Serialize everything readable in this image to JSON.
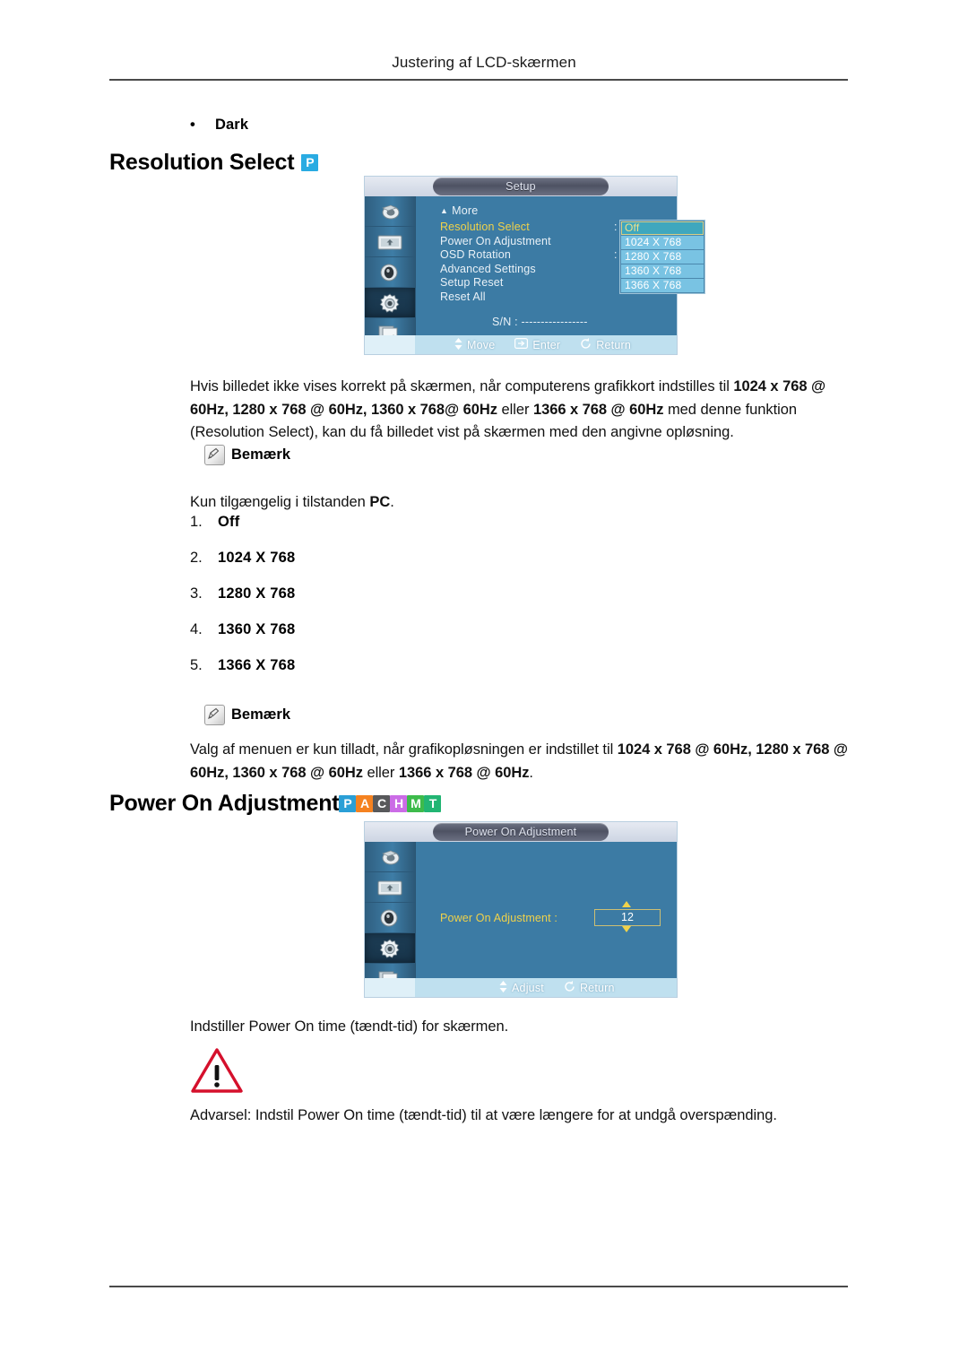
{
  "header": {
    "running_title": "Justering af LCD-skærmen"
  },
  "bullet": {
    "marker": "•",
    "label": "Dark"
  },
  "sections": {
    "resolution_select": {
      "title": "Resolution Select",
      "badges": [
        {
          "letter": "P",
          "color": "#29abe2"
        }
      ],
      "paragraph_plain_1": "Hvis billedet ikke vises korrekt på skærmen, når computerens grafikkort indstilles til ",
      "paragraph_bold_1": "1024 x 768 @ 60Hz, 1280 x 768 @ 60Hz, 1360 x 768@ 60Hz",
      "paragraph_plain_2": " eller ",
      "paragraph_bold_2": "1366 x 768 @ 60Hz",
      "paragraph_plain_3": " med denne funktion (Resolution Select), kan du få billedet vist på skærmen med den angivne opløsning.",
      "note_label": "Bemærk",
      "note_text_plain": "Kun tilgængelig i tilstanden ",
      "note_text_bold": "PC",
      "note_text_end": ".",
      "options": [
        {
          "num": "1.",
          "value": "Off"
        },
        {
          "num": "2.",
          "value": "1024 X 768"
        },
        {
          "num": "3.",
          "value": "1280 X 768"
        },
        {
          "num": "4.",
          "value": "1360 X 768"
        },
        {
          "num": "5.",
          "value": "1366 X 768"
        }
      ],
      "note2_label": "Bemærk",
      "note2_plain_1": "Valg af menuen er kun tilladt, når grafikopløsningen er indstillet til ",
      "note2_bold_1": "1024 x 768 @ 60Hz, 1280 x 768 @ 60Hz, 1360 x 768 @ 60Hz",
      "note2_plain_2": " eller ",
      "note2_bold_2": "1366 x 768 @ 60Hz",
      "note2_plain_3": "."
    },
    "power_on_adjustment": {
      "title": "Power On Adjustment",
      "badges": [
        {
          "letter": "P",
          "color": "#2a9fd6"
        },
        {
          "letter": "A",
          "color": "#f58220"
        },
        {
          "letter": "C",
          "color": "#58595b"
        },
        {
          "letter": "H",
          "color": "#cb6ce6"
        },
        {
          "letter": "M",
          "color": "#3dbb4b"
        },
        {
          "letter": "T",
          "color": "#22b573"
        }
      ],
      "description": "Indstiller Power On time (tændt-tid) for skærmen.",
      "warning_text": "Advarsel: Indstil Power On time (tændt-tid) til at være længere for at undgå overspænding.",
      "warning_icon_color": "#d5102c"
    }
  },
  "osd_setup": {
    "title": "Setup",
    "more_label": "More",
    "more_caret": "▲",
    "menu_items": [
      {
        "label": "Resolution Select",
        "active": true,
        "has_colon": true
      },
      {
        "label": "Power On Adjustment",
        "active": false,
        "has_colon": false
      },
      {
        "label": "OSD Rotation",
        "active": false,
        "has_colon": true
      },
      {
        "label": "Advanced Settings",
        "active": false,
        "has_colon": false
      },
      {
        "label": "Setup Reset",
        "active": false,
        "has_colon": false
      },
      {
        "label": "Reset All",
        "active": false,
        "has_colon": false
      }
    ],
    "dropdown": [
      {
        "value": "Off",
        "selected": true
      },
      {
        "value": "1024 X 768",
        "selected": false
      },
      {
        "value": "1280 X 768",
        "selected": false
      },
      {
        "value": "1360 X 768",
        "selected": false
      },
      {
        "value": "1366 X 768",
        "selected": false
      }
    ],
    "serial_label": "S/N :",
    "serial_value": "-----------------",
    "hints": [
      {
        "icon": "updown-arrows-icon",
        "label": "Move"
      },
      {
        "icon": "enter-key-icon",
        "label": "Enter"
      },
      {
        "icon": "return-arrow-icon",
        "label": "Return"
      }
    ],
    "rail_icons": [
      {
        "name": "input-source-icon",
        "selected": false
      },
      {
        "name": "picture-settings-icon",
        "selected": false
      },
      {
        "name": "sound-settings-icon",
        "selected": false
      },
      {
        "name": "setup-gear-icon",
        "selected": true
      },
      {
        "name": "multi-control-icon",
        "selected": false
      }
    ]
  },
  "osd_poweron": {
    "title": "Power On Adjustment",
    "field_label": "Power On Adjustment :",
    "field_value": "12",
    "hints": [
      {
        "icon": "updown-arrows-icon",
        "label": "Adjust"
      },
      {
        "icon": "return-arrow-icon",
        "label": "Return"
      }
    ],
    "rail_icons": [
      {
        "name": "input-source-icon",
        "selected": false
      },
      {
        "name": "picture-settings-icon",
        "selected": false
      },
      {
        "name": "sound-settings-icon",
        "selected": false
      },
      {
        "name": "setup-gear-icon",
        "selected": true
      },
      {
        "name": "multi-control-icon",
        "selected": false
      }
    ]
  }
}
